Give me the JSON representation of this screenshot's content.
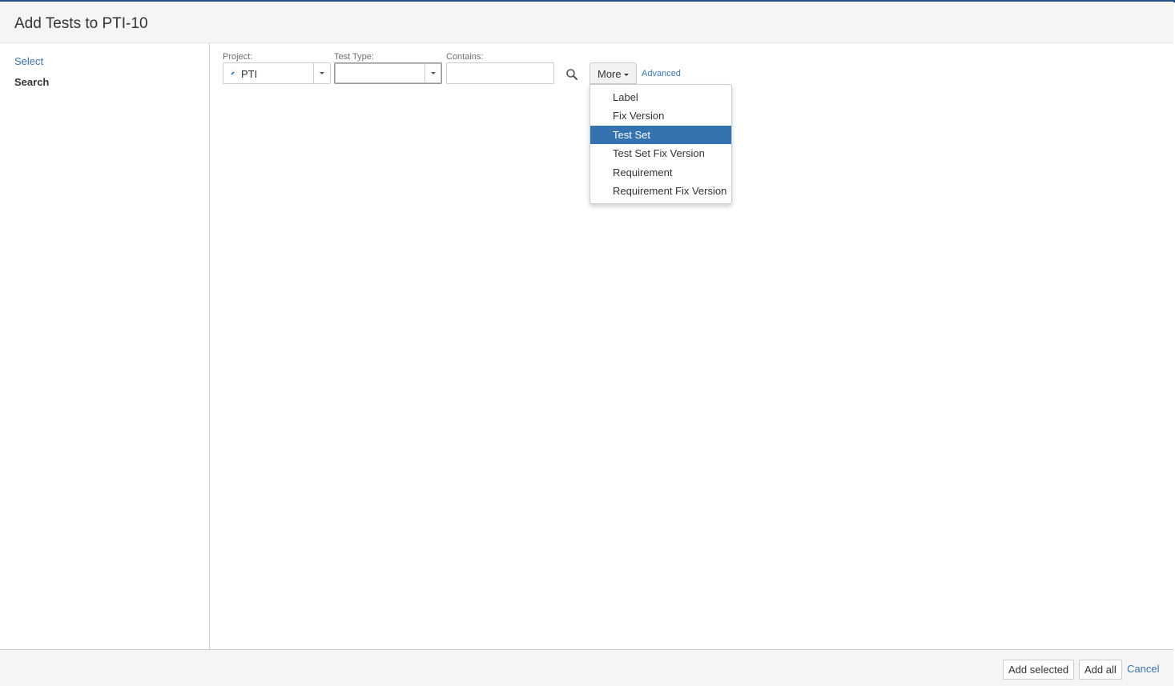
{
  "dialog": {
    "title": "Add Tests to PTI-10"
  },
  "sidebar": {
    "items": [
      {
        "label": "Select"
      },
      {
        "label": "Search"
      }
    ]
  },
  "filters": {
    "project": {
      "label": "Project:",
      "value": "PTI"
    },
    "test_type": {
      "label": "Test Type:",
      "value": ""
    },
    "contains": {
      "label": "Contains:",
      "value": ""
    },
    "more_label": "More",
    "advanced_label": "Advanced"
  },
  "more_menu": {
    "items": [
      {
        "label": "Label",
        "selected": false
      },
      {
        "label": "Fix Version",
        "selected": false
      },
      {
        "label": "Test Set",
        "selected": true
      },
      {
        "label": "Test Set Fix Version",
        "selected": false
      },
      {
        "label": "Requirement",
        "selected": false
      },
      {
        "label": "Requirement Fix Version",
        "selected": false
      }
    ]
  },
  "footer": {
    "add_selected": "Add selected",
    "add_all": "Add all",
    "cancel": "Cancel"
  },
  "colors": {
    "accent": "#3572b0",
    "link": "#3b73af"
  }
}
